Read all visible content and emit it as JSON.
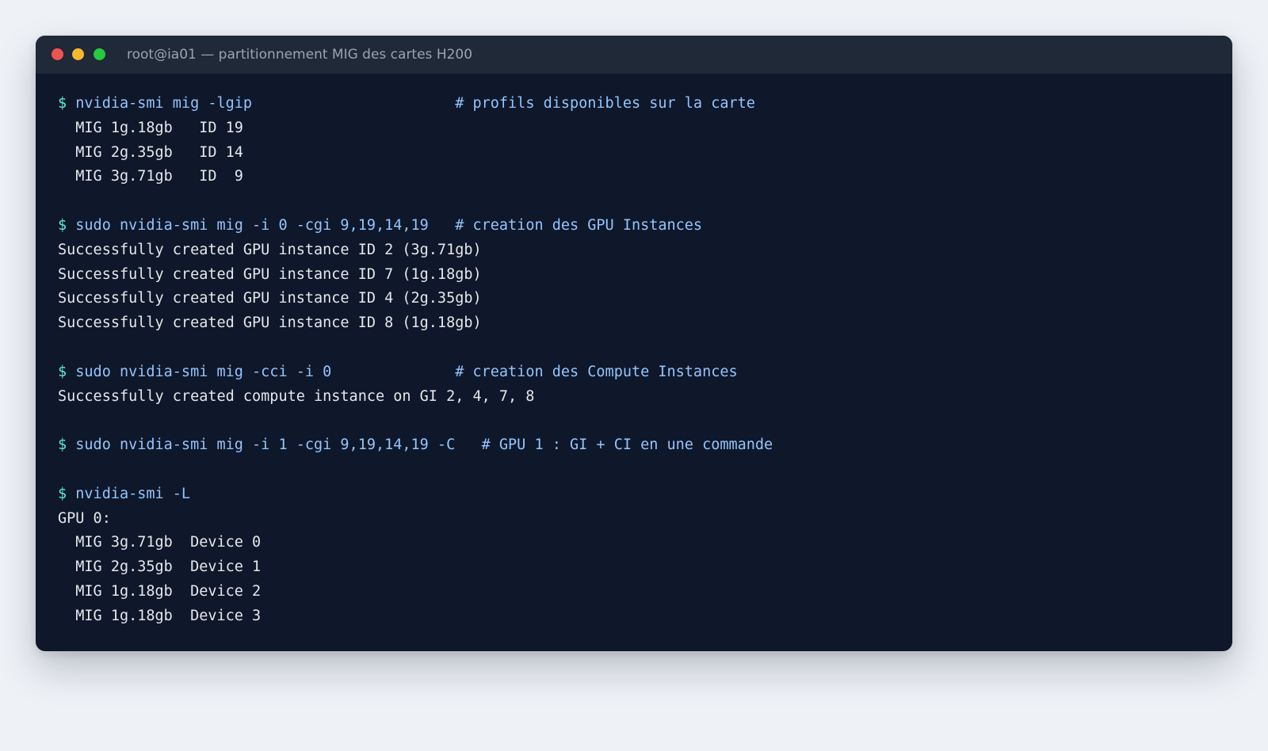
{
  "window": {
    "title": "root@ia01 — partitionnement MIG des cartes H200",
    "controls": [
      "close-button",
      "minimize-button",
      "maximize-button"
    ]
  },
  "colors": {
    "background": "#eef1f6",
    "terminal_bg": "#0f172a",
    "titlebar_bg": "#1f2937",
    "prompt": "#5eead4",
    "command": "#93c5fd",
    "output": "#e5e7eb",
    "close": "#ef5350",
    "minimize": "#f7b72e",
    "maximize": "#27c93f"
  },
  "terminal": {
    "lines": [
      {
        "type": "cmd",
        "prompt": "$ ",
        "text": "nvidia-smi mig -lgip                       # profils disponibles sur la carte"
      },
      {
        "type": "out",
        "text": "  MIG 1g.18gb   ID 19"
      },
      {
        "type": "out",
        "text": "  MIG 2g.35gb   ID 14"
      },
      {
        "type": "out",
        "text": "  MIG 3g.71gb   ID  9"
      },
      {
        "type": "blank",
        "text": ""
      },
      {
        "type": "cmd",
        "prompt": "$ ",
        "text": "sudo nvidia-smi mig -i 0 -cgi 9,19,14,19   # creation des GPU Instances"
      },
      {
        "type": "out",
        "text": "Successfully created GPU instance ID 2 (3g.71gb)"
      },
      {
        "type": "out",
        "text": "Successfully created GPU instance ID 7 (1g.18gb)"
      },
      {
        "type": "out",
        "text": "Successfully created GPU instance ID 4 (2g.35gb)"
      },
      {
        "type": "out",
        "text": "Successfully created GPU instance ID 8 (1g.18gb)"
      },
      {
        "type": "blank",
        "text": ""
      },
      {
        "type": "cmd",
        "prompt": "$ ",
        "text": "sudo nvidia-smi mig -cci -i 0              # creation des Compute Instances"
      },
      {
        "type": "out",
        "text": "Successfully created compute instance on GI 2, 4, 7, 8"
      },
      {
        "type": "blank",
        "text": ""
      },
      {
        "type": "cmd",
        "prompt": "$ ",
        "text": "sudo nvidia-smi mig -i 1 -cgi 9,19,14,19 -C   # GPU 1 : GI + CI en une commande"
      },
      {
        "type": "blank",
        "text": ""
      },
      {
        "type": "cmd",
        "prompt": "$ ",
        "text": "nvidia-smi -L"
      },
      {
        "type": "out",
        "text": "GPU 0:"
      },
      {
        "type": "out",
        "text": "  MIG 3g.71gb  Device 0"
      },
      {
        "type": "out",
        "text": "  MIG 2g.35gb  Device 1"
      },
      {
        "type": "out",
        "text": "  MIG 1g.18gb  Device 2"
      },
      {
        "type": "out",
        "text": "  MIG 1g.18gb  Device 3"
      }
    ]
  }
}
